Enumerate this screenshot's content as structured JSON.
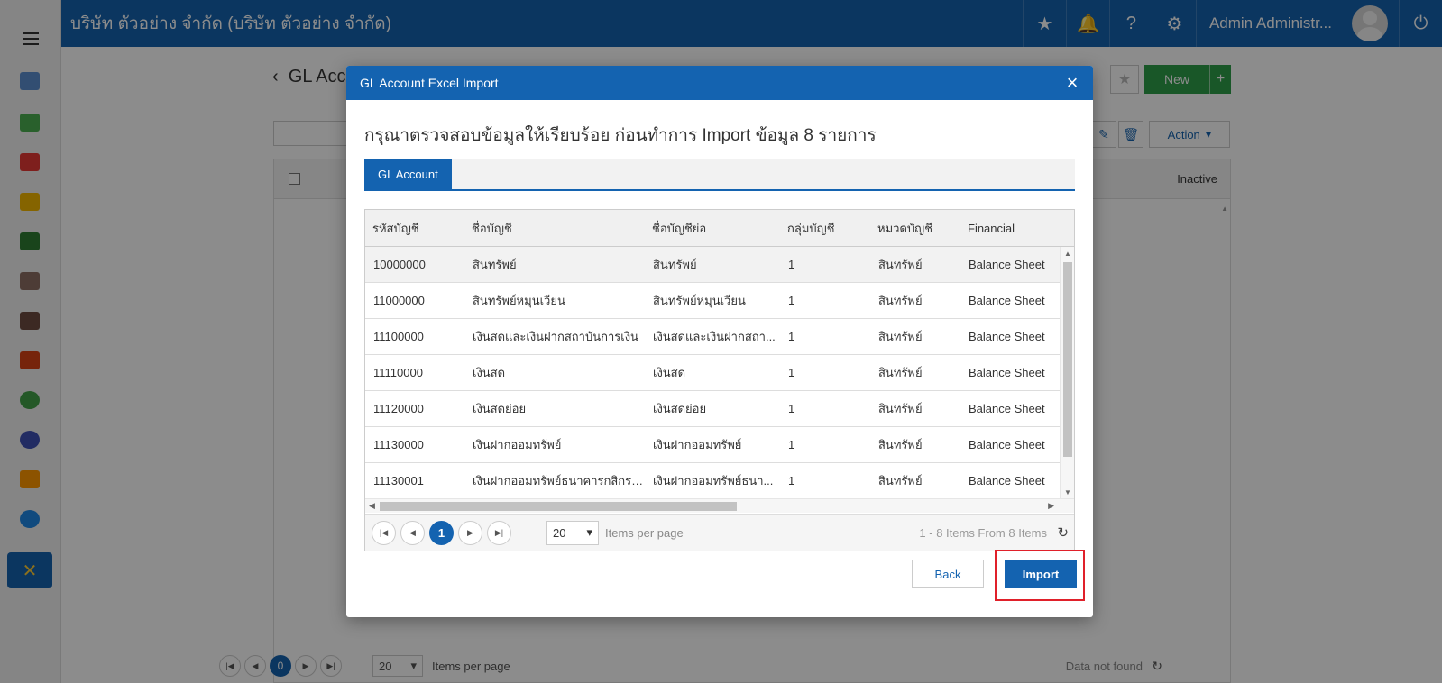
{
  "app": {
    "company": "บริษัท ตัวอย่าง จำกัด (บริษัท ตัวอย่าง จำกัด)",
    "user_name": "Admin Administr...",
    "brand_color": "#1463b0"
  },
  "topbar": {
    "icons": [
      "star-icon",
      "bell-icon",
      "help-icon",
      "gear-icon",
      "avatar",
      "power-icon"
    ]
  },
  "sidebar": {
    "icons": [
      "dashboard-icon",
      "money-icon",
      "cart-icon",
      "box-icon",
      "book-icon",
      "bank-icon",
      "wallet-icon",
      "user-icon",
      "check-icon",
      "chart-icon",
      "doc-icon",
      "search-icon",
      "tools-icon"
    ]
  },
  "page": {
    "title": "GL Acc",
    "new_label": "New",
    "action_label": "Action",
    "inactive_header": "Inactive",
    "pager": {
      "current": "0",
      "page_size": "20",
      "items_per_page": "Items per page",
      "status": "Data not found"
    }
  },
  "modal": {
    "title": "GL Account Excel Import",
    "message": "กรุณาตรวจสอบข้อมูลให้เรียบร้อย ก่อนทำการ Import ข้อมูล 8 รายการ",
    "tab_label": "GL Account",
    "columns": [
      "รหัสบัญชี",
      "ชื่อบัญชี",
      "ชื่อบัญชีย่อ",
      "กลุ่มบัญชี",
      "หมวดบัญชี",
      "Financial"
    ],
    "rows": [
      {
        "code": "10000000",
        "name": "สินทรัพย์",
        "short": "สินทรัพย์",
        "group": "1",
        "category": "สินทรัพย์",
        "financial": "Balance Sheet"
      },
      {
        "code": "11000000",
        "name": "สินทรัพย์หมุนเวียน",
        "short": "สินทรัพย์หมุนเวียน",
        "group": "1",
        "category": "สินทรัพย์",
        "financial": "Balance Sheet"
      },
      {
        "code": "11100000",
        "name": "เงินสดและเงินฝากสถาบันการเงิน",
        "short": "เงินสดและเงินฝากสถา...",
        "group": "1",
        "category": "สินทรัพย์",
        "financial": "Balance Sheet"
      },
      {
        "code": "11110000",
        "name": "เงินสด",
        "short": "เงินสด",
        "group": "1",
        "category": "สินทรัพย์",
        "financial": "Balance Sheet"
      },
      {
        "code": "11120000",
        "name": "เงินสดย่อย",
        "short": "เงินสดย่อย",
        "group": "1",
        "category": "สินทรัพย์",
        "financial": "Balance Sheet"
      },
      {
        "code": "11130000",
        "name": "เงินฝากออมทรัพย์",
        "short": "เงินฝากออมทรัพย์",
        "group": "1",
        "category": "สินทรัพย์",
        "financial": "Balance Sheet"
      },
      {
        "code": "11130001",
        "name": "เงินฝากออมทรัพย์ธนาคารกสิกรไ...",
        "short": "เงินฝากออมทรัพย์ธนา...",
        "group": "1",
        "category": "สินทรัพย์",
        "financial": "Balance Sheet"
      }
    ],
    "pager": {
      "current": "1",
      "page_size": "20",
      "items_per_page": "Items per page",
      "summary": "1 - 8 Items From 8 Items"
    },
    "back_label": "Back",
    "import_label": "Import"
  }
}
